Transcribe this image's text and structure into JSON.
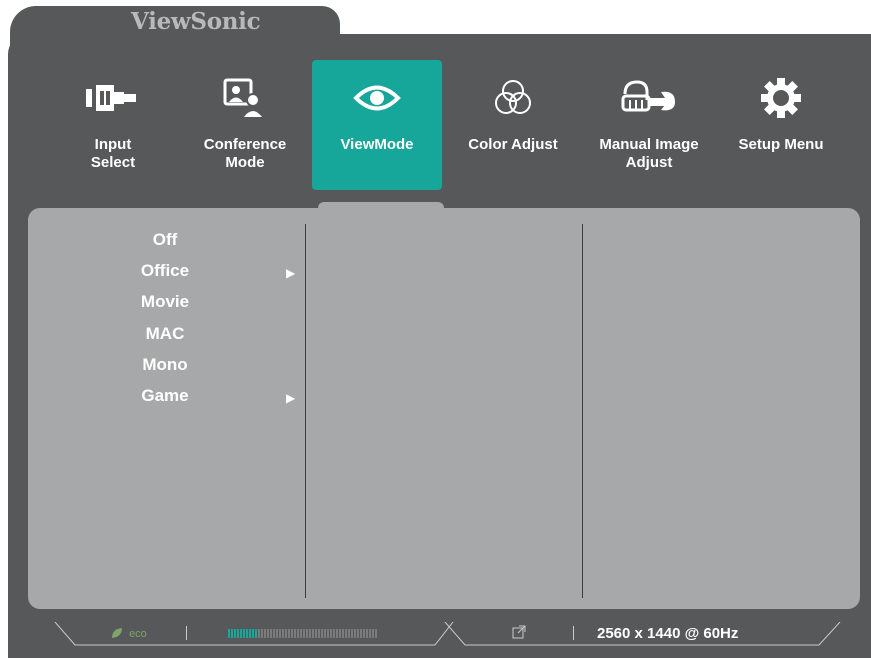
{
  "brand": "ViewSonic",
  "menu": {
    "items": [
      {
        "label": "Input\nSelect",
        "icon": "input-select-icon",
        "active": false
      },
      {
        "label": "Conference\nMode",
        "icon": "conference-mode-icon",
        "active": false
      },
      {
        "label": "ViewMode",
        "icon": "eye-icon",
        "active": true
      },
      {
        "label": "Color Adjust",
        "icon": "color-circles-icon",
        "active": false
      },
      {
        "label": "Manual Image\nAdjust",
        "icon": "hand-wrench-icon",
        "active": false
      },
      {
        "label": "Setup Menu",
        "icon": "gear-icon",
        "active": false
      }
    ]
  },
  "viewmode": {
    "options": [
      {
        "label": "Off",
        "has_submenu": false
      },
      {
        "label": "Office",
        "has_submenu": true
      },
      {
        "label": "Movie",
        "has_submenu": false
      },
      {
        "label": "MAC",
        "has_submenu": false
      },
      {
        "label": "Mono",
        "has_submenu": false
      },
      {
        "label": "Game",
        "has_submenu": true
      }
    ],
    "submenu_arrow": "▶"
  },
  "status": {
    "eco_label": "eco",
    "volume_level": 0.2,
    "resolution": "2560 x 1440 @ 60Hz"
  },
  "colors": {
    "shell": "#57585a",
    "panel": "#a7a8aa",
    "accent": "#17a69a"
  }
}
